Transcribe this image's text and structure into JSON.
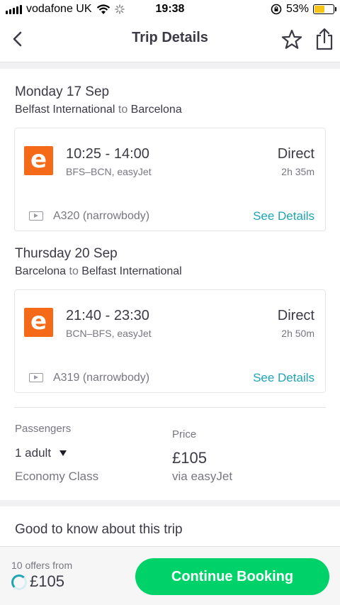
{
  "status_bar": {
    "carrier": "vodafone UK",
    "time": "19:38",
    "battery": "53%",
    "battery_level": 0.53,
    "accent_battery": "#f5c518"
  },
  "header": {
    "title": "Trip Details",
    "back_icon": "chevron-left-icon",
    "star_icon": "star-icon",
    "share_icon": "share-icon"
  },
  "legs": [
    {
      "date": "Monday 17 Sep",
      "origin": "Belfast International",
      "connector": "to",
      "destination": "Barcelona",
      "airline_logo_letter": "e",
      "times": "10:25 - 14:00",
      "route": "BFS–BCN, easyJet",
      "stops": "Direct",
      "duration": "2h 35m",
      "aircraft": "A320 (narrowbody)",
      "details_label": "See Details"
    },
    {
      "date": "Thursday 20 Sep",
      "origin": "Barcelona",
      "connector": "to",
      "destination": "Belfast International",
      "airline_logo_letter": "e",
      "times": "21:40 - 23:30",
      "route": "BCN–BFS, easyJet",
      "stops": "Direct",
      "duration": "2h 50m",
      "aircraft": "A319 (narrowbody)",
      "details_label": "See Details"
    }
  ],
  "summary": {
    "passengers_label": "Passengers",
    "passengers_value": "1 adult",
    "cabin_class": "Economy Class",
    "price_label": "Price",
    "price_value": "£105",
    "price_via": "via easyJet"
  },
  "good_to_know": {
    "title": "Good to know about this trip"
  },
  "footer": {
    "offers_text": "10 offers from",
    "total_price": "£105",
    "cta_label": "Continue Booking"
  },
  "colors": {
    "accent_teal": "#1fa4b5",
    "cta_green": "#00d26a",
    "easyjet_orange": "#f56a19"
  }
}
